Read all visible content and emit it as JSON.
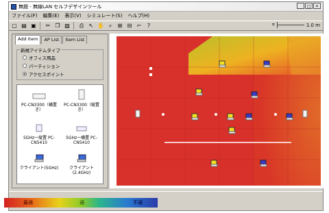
{
  "window": {
    "title": "無題 - 無線LAN セルフデザインツール",
    "buttons": [
      "_",
      "□",
      "×"
    ]
  },
  "menu": [
    "ファイル(F)",
    "編集(E)",
    "表示(V)",
    "シミュレート(S)",
    "ヘルプ(H)"
  ],
  "toolbar": {
    "zoom_value": "1.0 m"
  },
  "tabs": [
    "Add Item",
    "AP List",
    "Item List"
  ],
  "group": {
    "title": "新規アイテムタイプ",
    "options": [
      "オフィス用品",
      "パーティション",
      "アクセスポイント"
    ],
    "selected": "アクセスポイント"
  },
  "items": [
    {
      "label": "PC-CN3300（横置き）",
      "icon": "ap-horizontal-icon"
    },
    {
      "label": "PC-CN3300（縦置き）",
      "icon": "ap-vertical-icon"
    },
    {
      "label": "5GHz一縦置 PC-CN5410",
      "icon": "ap-5g-vertical-icon"
    },
    {
      "label": "5GHz一横置 PC-CN5410",
      "icon": "ap-5g-horizontal-icon"
    },
    {
      "label": "クライアント(5GHz)",
      "icon": "laptop-icon"
    },
    {
      "label": "クライアント(2.4GHz)",
      "icon": "laptop-icon"
    }
  ],
  "legend": {
    "labels": [
      "最適",
      "適",
      "不適"
    ],
    "colors": [
      "#d42020",
      "#8ecb2a",
      "#2a3aa8"
    ]
  }
}
